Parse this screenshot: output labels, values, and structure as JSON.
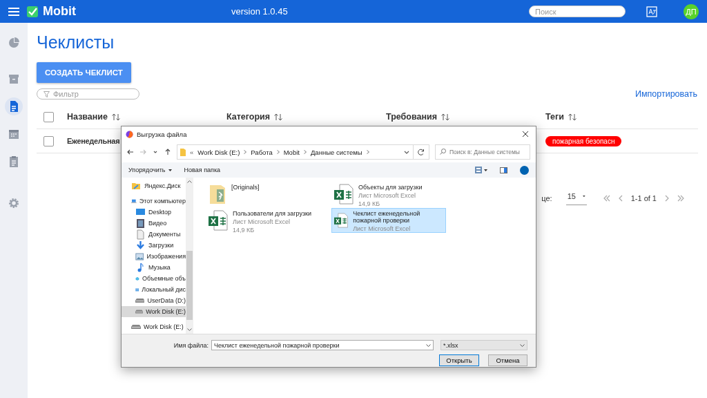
{
  "topbar": {
    "app_name": "Mobit",
    "version": "version 1.0.45",
    "search": {
      "placeholder": "Поиск"
    },
    "avatar": "ДП"
  },
  "sidebar": {
    "items": [
      {
        "selected": false
      },
      {
        "selected": false
      },
      {
        "selected": true
      },
      {
        "selected": false
      },
      {
        "selected": false
      },
      {
        "selected": false
      }
    ]
  },
  "page": {
    "title": "Чеклисты",
    "create_button": "СОЗДАТЬ ЧЕКЛИСТ",
    "filter": {
      "placeholder": "Фильтр"
    },
    "import_link": "Импортировать"
  },
  "table": {
    "all_checked": false,
    "columns": [
      "Название",
      "Категория",
      "Требования",
      "Теги"
    ],
    "rows": [
      {
        "checked": false,
        "name": "Еженедельная",
        "tags": [
          {
            "label": "пожарная безопасн",
            "color": "#ff0000"
          }
        ]
      }
    ]
  },
  "pagination": {
    "rows_label": "це:",
    "rows_per_page": "15",
    "range": "1-1 of 1"
  },
  "dialog": {
    "title": "Выгрузка файла",
    "path": [
      "«",
      "Work Disk (E:)",
      "Работа",
      "Mobit",
      "Данные системы"
    ],
    "search": {
      "placeholder": "Поиск в: Данные системы"
    },
    "toolbar": [
      "Упорядочить",
      "Новая папка"
    ],
    "nav": [
      {
        "label": "Яндекс.Диск",
        "selected": false
      },
      {
        "label": "Этот компьютер",
        "selected": false,
        "children": [
          {
            "label": "Desktop",
            "selected": false
          },
          {
            "label": "Видео",
            "selected": false
          },
          {
            "label": "Документы",
            "selected": false
          },
          {
            "label": "Загрузки",
            "selected": false
          },
          {
            "label": "Изображения",
            "selected": false
          },
          {
            "label": "Музыка",
            "selected": false
          },
          {
            "label": "Объемные объ",
            "selected": false
          },
          {
            "label": "Локальный дис",
            "selected": false
          },
          {
            "label": "UserData (D:)",
            "selected": false
          },
          {
            "label": "Work Disk (E:)",
            "selected": true
          }
        ]
      },
      {
        "label": "Work Disk (E:)",
        "selected": false
      }
    ],
    "files": [
      {
        "kind": "folder",
        "name": "[Originals]",
        "selected": false
      },
      {
        "kind": "excel",
        "name": "Объекты для загрузки",
        "type": "Лист Microsoft Excel",
        "size": "14,9 КБ",
        "selected": false
      },
      {
        "kind": "excel",
        "name": "Пользователи для загрузки",
        "type": "Лист Microsoft Excel",
        "size": "14,9 КБ",
        "selected": false
      },
      {
        "kind": "excel",
        "name": "Чеклист еженедельной пожарной проверки",
        "type": "Лист Microsoft Excel",
        "selected": true
      }
    ],
    "filename_label": "Имя файла:",
    "filename": "Чеклист еженедельной пожарной проверки",
    "filetype": "*.xlsx",
    "buttons": [
      "Открыть",
      "Отмена"
    ]
  }
}
